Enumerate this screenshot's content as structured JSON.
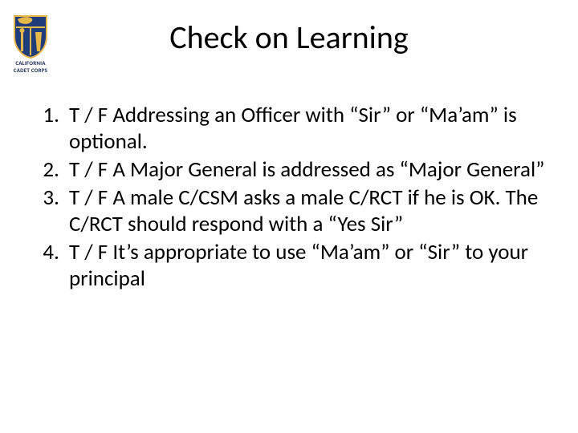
{
  "logo": {
    "label_line1": "CALIFORNIA",
    "label_line2": "CADET CORPS",
    "colors": {
      "shield_blue": "#1f3d7a",
      "shield_gold": "#e6b84a"
    }
  },
  "title": "Check on Learning",
  "tf_label": "T / F",
  "questions": [
    {
      "text": "Addressing an Officer with “Sir” or “Ma’am” is optional."
    },
    {
      "text": "A Major General is addressed as “Major General”"
    },
    {
      "text": "A male C/CSM asks a male C/RCT if he is OK.  The C/RCT should respond with a “Yes Sir”"
    },
    {
      "text": "It’s appropriate to use “Ma’am” or “Sir” to your principal"
    }
  ]
}
